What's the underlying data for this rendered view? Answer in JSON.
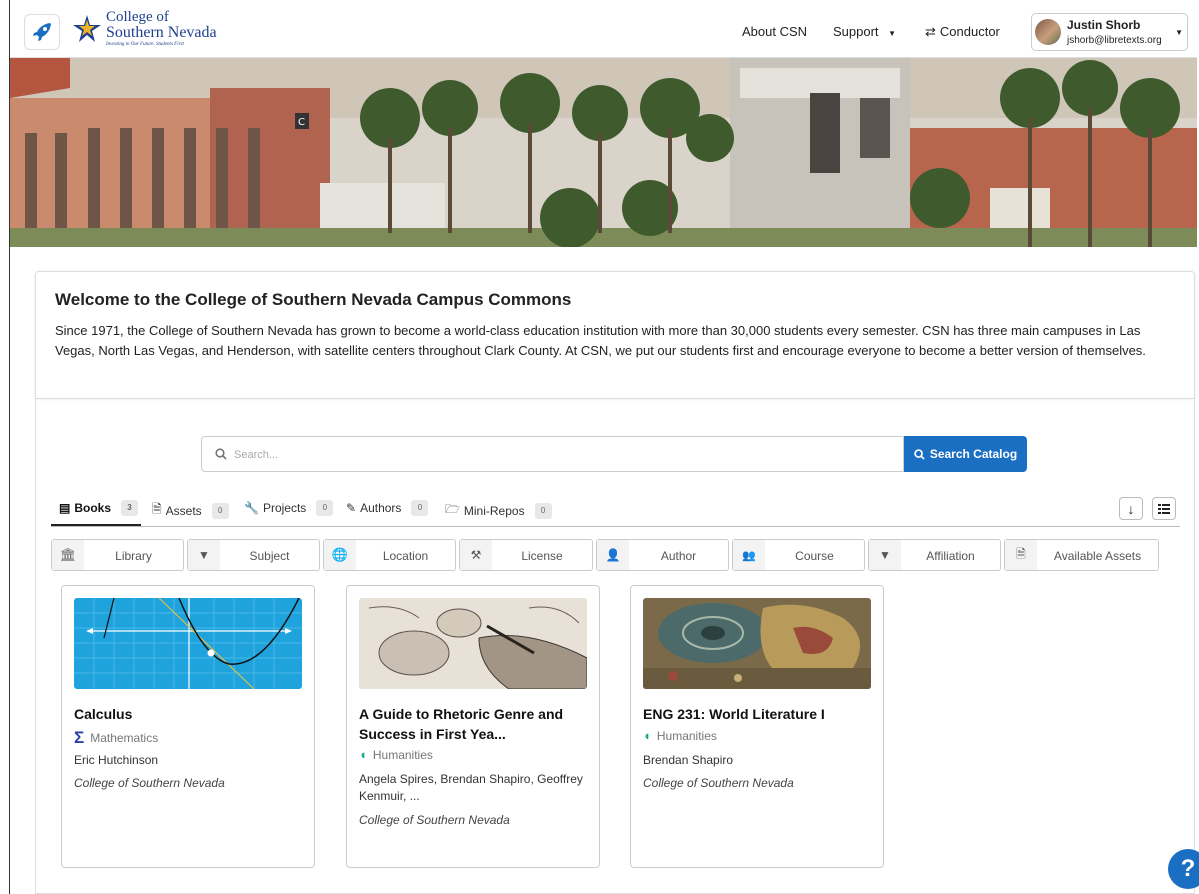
{
  "nav": {
    "logo_line1": "College of",
    "logo_line2": "Southern Nevada",
    "logo_tagline": "Investing in Our Future. Students First",
    "about_label": "About CSN",
    "support_label": "Support",
    "conductor_label": "Conductor",
    "user_name": "Justin Shorb",
    "user_email": "jshorb@libretexts.org"
  },
  "welcome": {
    "title": "Welcome to the College of Southern Nevada Campus Commons",
    "body": "Since 1971, the College of Southern Nevada has grown to become a world-class education institution with more than 30,000 students every semester. CSN has three main campuses in Las Vegas, North Las Vegas, and Henderson, with satellite centers throughout Clark County. At CSN, we put our students first and encourage everyone to become a better version of themselves."
  },
  "search": {
    "placeholder": "Search...",
    "button_label": "Search Catalog"
  },
  "tabs": [
    {
      "label": "Books",
      "count": "3"
    },
    {
      "label": "Assets",
      "count": "0"
    },
    {
      "label": "Projects",
      "count": "0"
    },
    {
      "label": "Authors",
      "count": "0"
    },
    {
      "label": "Mini-Repos",
      "count": "0"
    }
  ],
  "filters": [
    "Library",
    "Subject",
    "Location",
    "License",
    "Author",
    "Course",
    "Affiliation",
    "Available Assets"
  ],
  "books": [
    {
      "title": "Calculus",
      "subject": "Mathematics",
      "author": "Eric Hutchinson",
      "institution": "College of Southern Nevada"
    },
    {
      "title": "A Guide to Rhetoric Genre and Success in First Yea...",
      "subject": "Humanities",
      "author": "Angela Spires, Brendan Shapiro, Geoffrey Kenmuir, ...",
      "institution": "College of Southern Nevada"
    },
    {
      "title": "ENG 231: World Literature I",
      "subject": "Humanities",
      "author": "Brendan Shapiro",
      "institution": "College of Southern Nevada"
    }
  ],
  "help_label": "?",
  "colors": {
    "primary": "#1a6fc2",
    "logo_blue": "#1f3f8f",
    "humanities": "#1aa88a",
    "math": "#2b3fa8"
  }
}
